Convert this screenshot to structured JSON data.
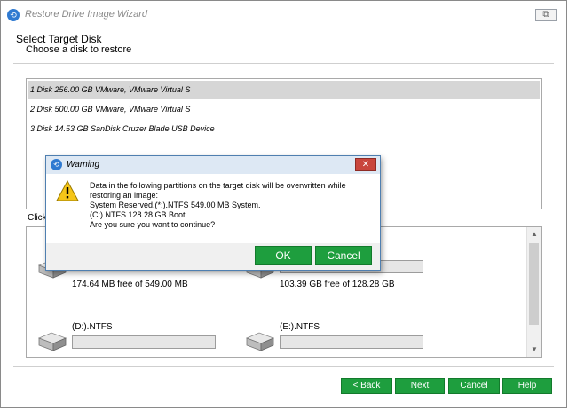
{
  "window": {
    "title": "Restore Drive Image Wizard",
    "close_glyph": "⧉"
  },
  "header": {
    "title": "Select Target Disk",
    "subtitle": "Choose a disk to restore"
  },
  "disks": [
    {
      "label": "1 Disk 256.00 GB VMware,  VMware Virtual S",
      "selected": true
    },
    {
      "label": "2 Disk 500.00 GB VMware,  VMware Virtual S",
      "selected": false
    },
    {
      "label": "3 Disk 14.53 GB SanDisk Cruzer Blade USB Device",
      "selected": false
    }
  ],
  "partition_hint": "Click",
  "partitions": [
    {
      "name": "",
      "free": "174.64 MB free of 549.00 MB"
    },
    {
      "name": "",
      "free": "103.39 GB free of 128.28 GB"
    },
    {
      "name": "(D:).NTFS",
      "free": ""
    },
    {
      "name": "(E:).NTFS",
      "free": ""
    }
  ],
  "buttons": {
    "back": "< Back",
    "next": "Next",
    "cancel": "Cancel",
    "help": "Help"
  },
  "dialog": {
    "title": "Warning",
    "close_glyph": "✕",
    "message_lines": [
      "Data in the following partitions on the target disk will be overwritten while",
      "restoring an image:",
      "System Reserved,(*:).NTFS 549.00 MB System.",
      "(C:).NTFS 128.28 GB Boot.",
      "Are you sure you want to continue?"
    ],
    "ok": "OK",
    "cancel": "Cancel"
  },
  "icons": {
    "app": "disk-restore-icon",
    "warning": "warning-icon",
    "drive": "hard-drive-icon"
  },
  "colors": {
    "accent_green": "#1e9e3e",
    "dialog_close": "#c9463d",
    "selection": "#d6d6d6"
  }
}
